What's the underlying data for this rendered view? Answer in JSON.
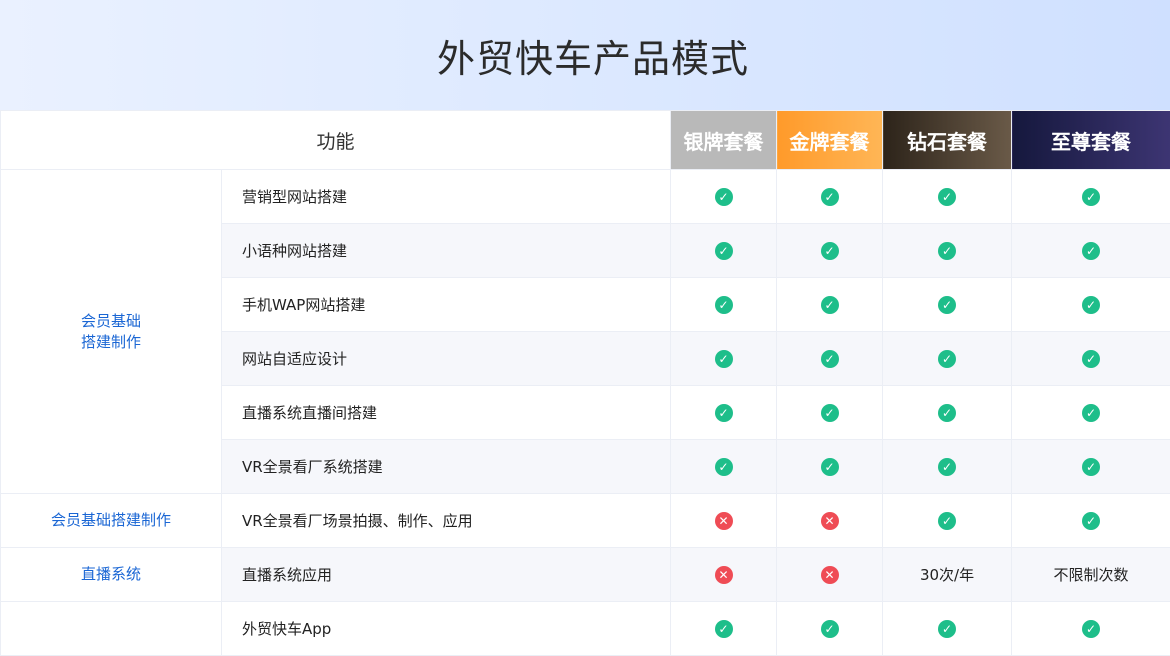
{
  "page": {
    "title": "外贸快车产品模式"
  },
  "table": {
    "header": {
      "function_label": "功能",
      "plans": [
        "银牌套餐",
        "金牌套餐",
        "钻石套餐",
        "至尊套餐"
      ]
    },
    "categories": {
      "basic": "会员基础\n搭建制作",
      "basic_2": "会员基础搭建制作",
      "live": "直播系统"
    },
    "rows": [
      {
        "feature": "营销型网站搭建",
        "cells": [
          "check",
          "check",
          "check",
          "check"
        ]
      },
      {
        "feature": "小语种网站搭建",
        "cells": [
          "check",
          "check",
          "check",
          "check"
        ]
      },
      {
        "feature": "手机WAP网站搭建",
        "cells": [
          "check",
          "check",
          "check",
          "check"
        ]
      },
      {
        "feature": "网站自适应设计",
        "cells": [
          "check",
          "check",
          "check",
          "check"
        ]
      },
      {
        "feature": "直播系统直播间搭建",
        "cells": [
          "check",
          "check",
          "check",
          "check"
        ]
      },
      {
        "feature": "VR全景看厂系统搭建",
        "cells": [
          "check",
          "check",
          "check",
          "check"
        ]
      },
      {
        "feature": "VR全景看厂场景拍摄、制作、应用",
        "cells": [
          "cross",
          "cross",
          "check",
          "check"
        ]
      },
      {
        "feature": "直播系统应用",
        "cells": [
          "cross",
          "cross",
          "30次/年",
          "不限制次数"
        ]
      },
      {
        "feature": "外贸快车App",
        "cells": [
          "check",
          "check",
          "check",
          "check"
        ]
      }
    ]
  },
  "icons": {
    "check": {
      "name": "check-circle-icon",
      "color": "#1ebe8a"
    },
    "cross": {
      "name": "cross-circle-icon",
      "color": "#ef4c55"
    }
  }
}
